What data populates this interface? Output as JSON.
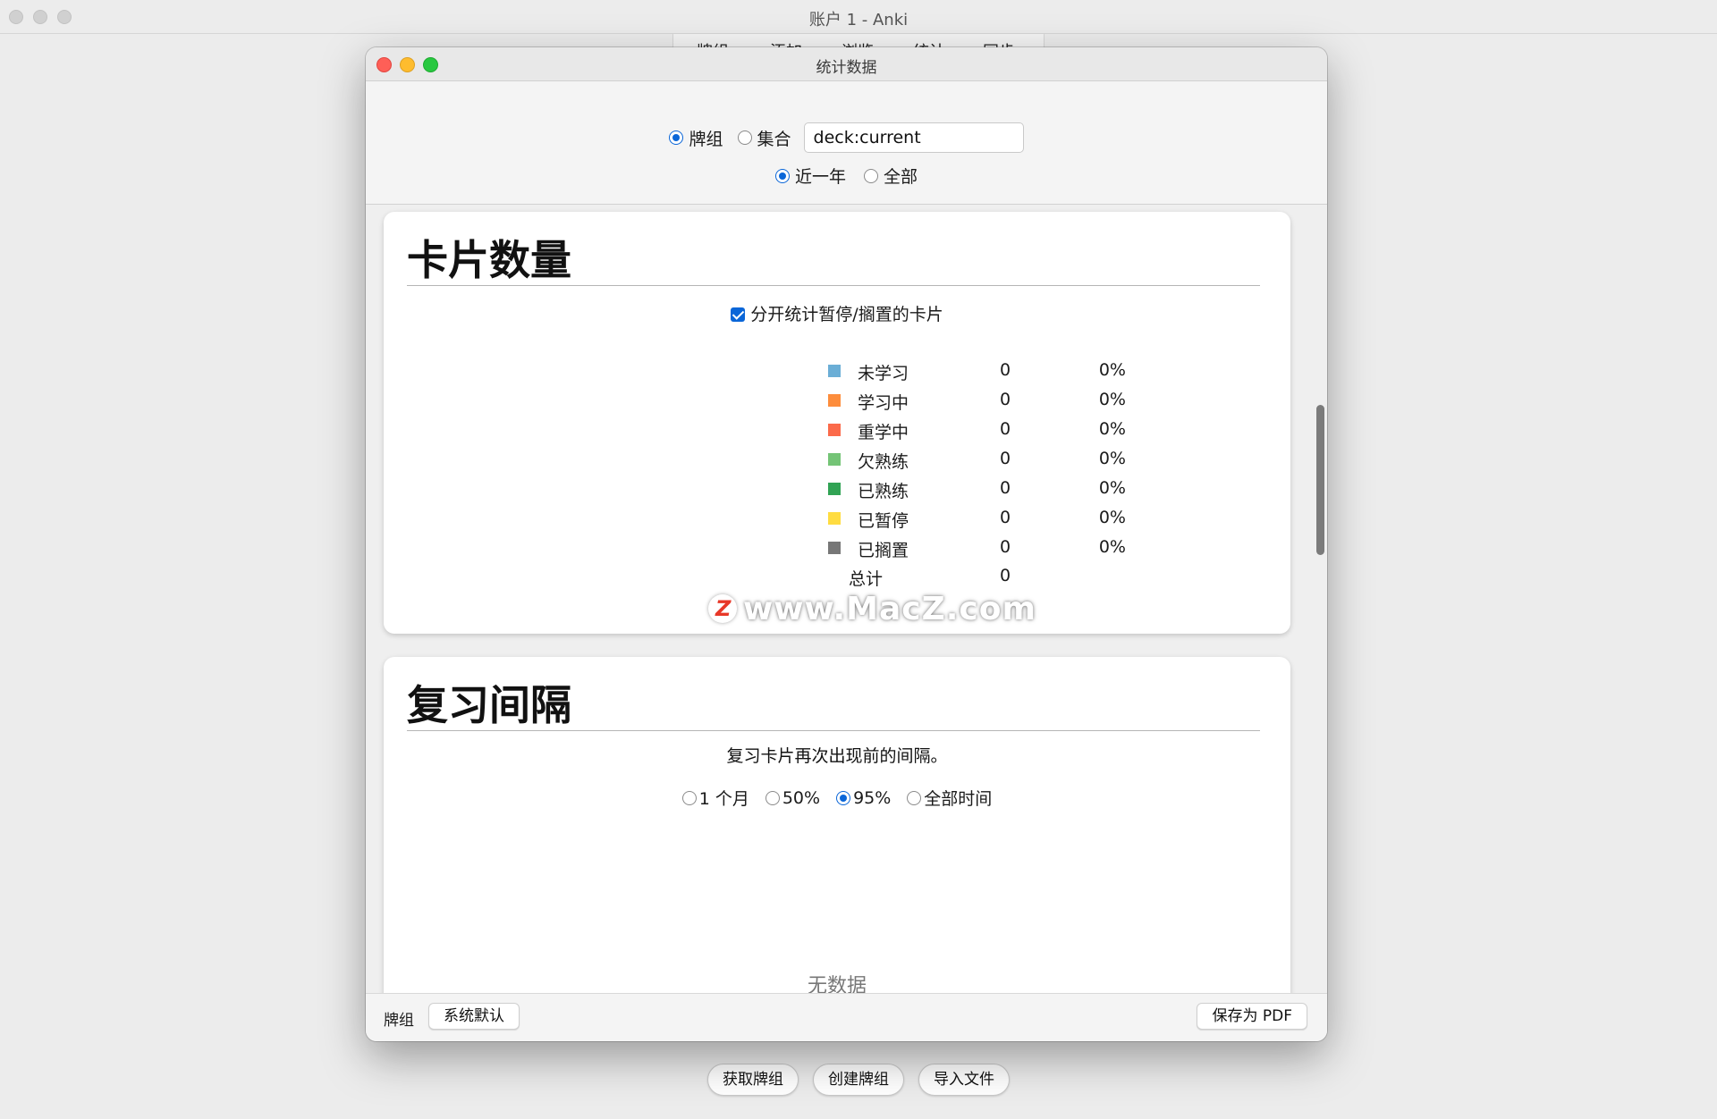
{
  "main_window": {
    "title": "账户 1 - Anki",
    "menu_visible_text": [
      "牌组",
      "添加",
      "浏览",
      "统计",
      "同步"
    ],
    "bottom_buttons": [
      "获取牌组",
      "创建牌组",
      "导入文件"
    ]
  },
  "dialog": {
    "title": "统计数据",
    "scope": {
      "deck_label": "牌组",
      "collection_label": "集合",
      "selected": "牌组",
      "search_value": "deck:current"
    },
    "period": {
      "year_label": "近一年",
      "all_label": "全部",
      "selected": "近一年"
    },
    "card_counts": {
      "title": "卡片数量",
      "checkbox_label": "分开统计暂停/搁置的卡片",
      "checkbox_checked": true,
      "rows": [
        {
          "label": "未学习",
          "count": "0",
          "pct": "0%",
          "color": "#6baed6"
        },
        {
          "label": "学习中",
          "count": "0",
          "pct": "0%",
          "color": "#fd8d3c"
        },
        {
          "label": "重学中",
          "count": "0",
          "pct": "0%",
          "color": "#fb6a4a"
        },
        {
          "label": "欠熟练",
          "count": "0",
          "pct": "0%",
          "color": "#74c476"
        },
        {
          "label": "已熟练",
          "count": "0",
          "pct": "0%",
          "color": "#31a354"
        },
        {
          "label": "已暂停",
          "count": "0",
          "pct": "0%",
          "color": "#ffdc41"
        },
        {
          "label": "已搁置",
          "count": "0",
          "pct": "0%",
          "color": "#777777"
        }
      ],
      "total_label": "总计",
      "total_count": "0"
    },
    "watermark": {
      "text": "www.MacZ.com",
      "logo_letter": "Z"
    },
    "review_intervals": {
      "title": "复习间隔",
      "subtitle": "复习卡片再次出现前的间隔。",
      "ranges": [
        "1 个月",
        "50%",
        "95%",
        "全部时间"
      ],
      "selected_range": "95%",
      "empty_text": "无数据"
    },
    "footer": {
      "deck_label": "牌组",
      "preset_button": "系统默认",
      "save_pdf_button": "保存为 PDF"
    }
  }
}
